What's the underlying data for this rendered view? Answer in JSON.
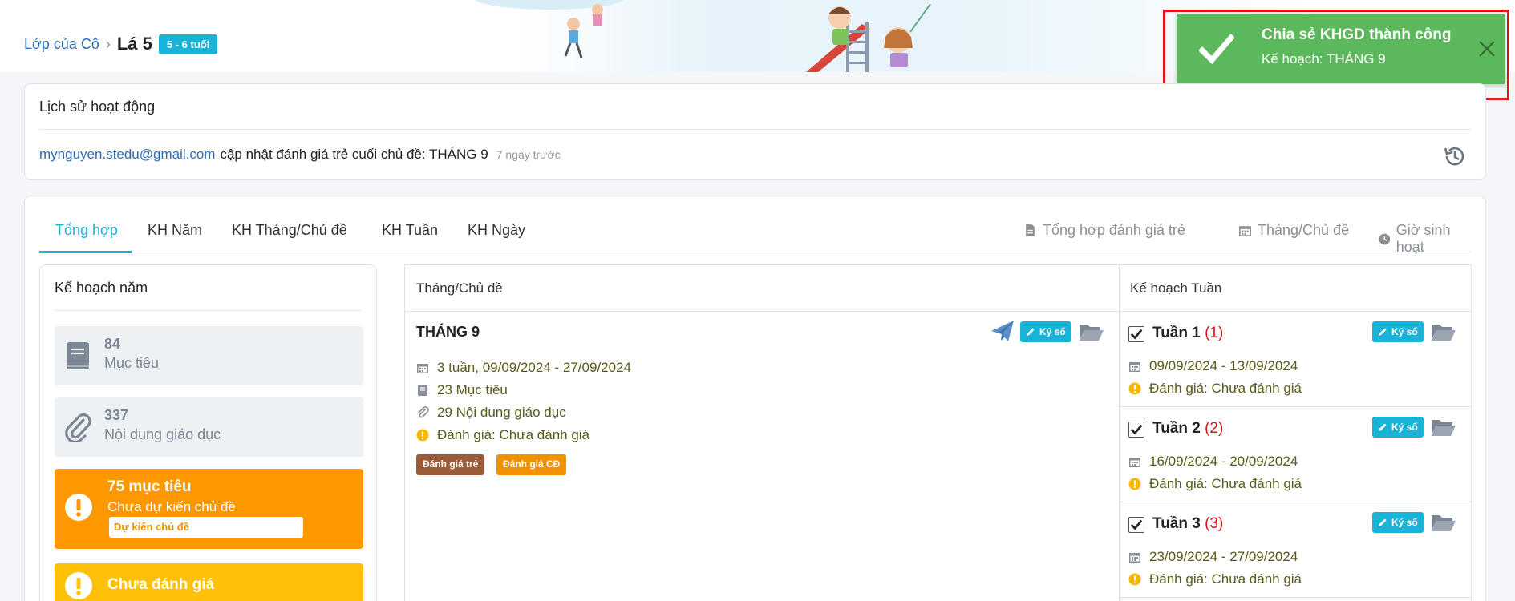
{
  "breadcrumb": {
    "link": "Lớp của Cô",
    "current": "Lá 5",
    "badge": "5 - 6 tuổi"
  },
  "toast": {
    "title": "Chia sẻ KHGD thành công",
    "message": "Kế hoạch: THÁNG 9"
  },
  "activity": {
    "title": "Lịch sử hoạt động",
    "email": "mynguyen.stedu@gmail.com",
    "text": "cập nhật đánh giá trẻ cuối chủ đề: THÁNG 9",
    "time": "7 ngày trước"
  },
  "tabs": [
    "Tổng hợp",
    "KH Năm",
    "KH Tháng/Chủ đề",
    "KH Tuần",
    "KH Ngày"
  ],
  "tab_links": [
    "Tổng hợp đánh giá trẻ",
    "Tháng/Chủ đề",
    "Giờ sinh hoạt"
  ],
  "left_panel": {
    "title": "Kế hoạch năm",
    "stats": [
      {
        "number": "84",
        "label": "Mục tiêu",
        "icon": "book-icon"
      },
      {
        "number": "337",
        "label": "Nội dung giáo dục",
        "icon": "paperclip-icon"
      }
    ],
    "alert_orange": {
      "title": "75 mục tiêu",
      "subtitle": "Chưa dự kiến chủ đề",
      "button": "Dự kiến chủ đề"
    },
    "alert_yellow": {
      "title": "Chưa đánh giá"
    }
  },
  "table": {
    "col_month": "Tháng/Chủ đề",
    "col_week": "Kế hoạch Tuần",
    "month": {
      "title": "THÁNG 9",
      "duration": "3 tuần, 09/09/2024 - 27/09/2024",
      "goals": "23 Mục tiêu",
      "contents": "29 Nội dung giáo dục",
      "evaluation": "Đánh giá: Chưa đánh giá",
      "tag_children": "Đánh giá trẻ",
      "tag_topic": "Đánh giá CĐ",
      "sign_label": "Ký số"
    },
    "weeks": [
      {
        "name": "Tuần 1",
        "count": "(1)",
        "dates": "09/09/2024 - 13/09/2024",
        "evaluation": "Đánh giá: Chưa đánh giá",
        "sign_label": "Ký số"
      },
      {
        "name": "Tuần 2",
        "count": "(2)",
        "dates": "16/09/2024 - 20/09/2024",
        "evaluation": "Đánh giá: Chưa đánh giá",
        "sign_label": "Ký số"
      },
      {
        "name": "Tuần 3",
        "count": "(3)",
        "dates": "23/09/2024 - 27/09/2024",
        "evaluation": "Đánh giá: Chưa đánh giá",
        "sign_label": "Ký số"
      }
    ]
  },
  "colors": {
    "accent": "#1ab3d8",
    "toast_green": "#5cb85c",
    "orange": "#ff9800",
    "yellow": "#ffc107",
    "brown_tag": "#9c5b3b",
    "red": "#d9141b"
  }
}
